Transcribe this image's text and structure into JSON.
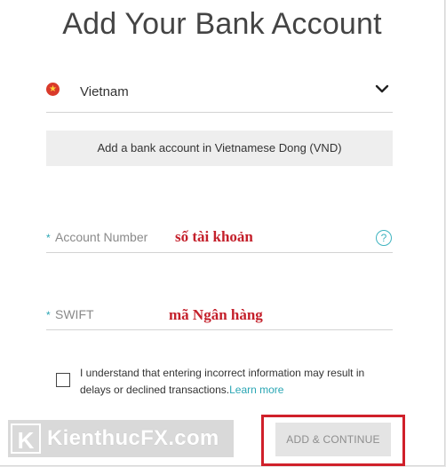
{
  "title": "Add Your Bank Account",
  "country": {
    "name": "Vietnam",
    "flag_icon": "vietnam-flag-icon",
    "chevron_icon": "chevron-down-icon"
  },
  "currency_label": "Add a bank account in Vietnamese Dong (VND)",
  "fields": {
    "account_number": {
      "required_mark": "*",
      "placeholder": "Account Number",
      "annotation": "số tài khoản",
      "help_icon": "help-icon",
      "help_glyph": "?"
    },
    "swift": {
      "required_mark": "*",
      "placeholder": "SWIFT",
      "annotation": "mã Ngân hàng"
    }
  },
  "consent": {
    "text": "I understand that entering incorrect information may result in delays or declined transactions.",
    "link": "Learn more"
  },
  "submit_label": "ADD & CONTINUE",
  "watermark": {
    "letter": "K",
    "text": "KienthucFX.com"
  },
  "colors": {
    "accent": "#2aa6b4",
    "annotation_red": "#c4202b",
    "highlight_red": "#d0202a",
    "flag_red": "#d93a2b"
  }
}
